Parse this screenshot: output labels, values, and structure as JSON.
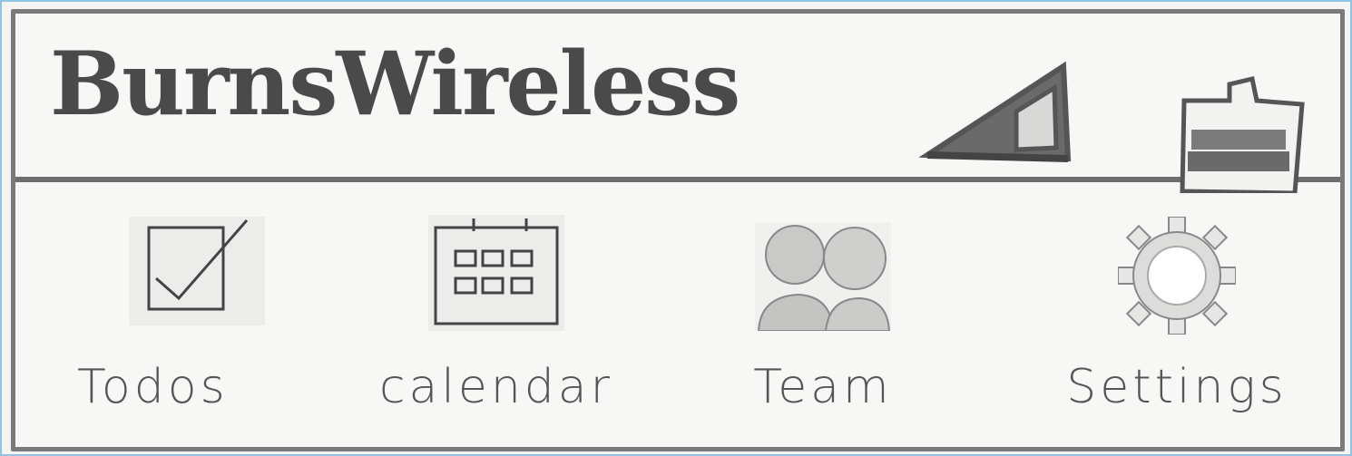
{
  "header": {
    "app_title": "BurnsWireless",
    "icons": [
      "signal-icon",
      "battery-icon"
    ]
  },
  "nav": {
    "items": [
      {
        "label": "Todos",
        "icon": "checkbox-icon"
      },
      {
        "label": "Calendar",
        "icon": "calendar-icon"
      },
      {
        "label": "Team",
        "icon": "team-icon"
      },
      {
        "label": "Settings",
        "icon": "gear-icon"
      }
    ]
  },
  "colors": {
    "frame_border": "#8fc4e2",
    "panel_border": "#7a7a7a",
    "ink": "#4a4a4a"
  }
}
